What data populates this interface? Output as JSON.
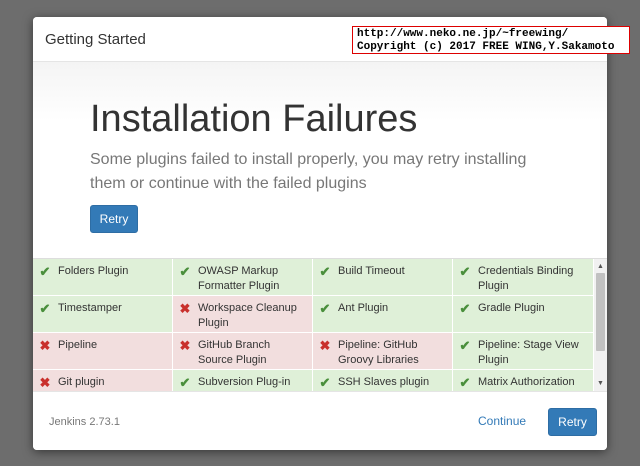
{
  "dialog": {
    "title": "Getting Started"
  },
  "watermark": {
    "line1": "http://www.neko.ne.jp/~freewing/",
    "line2": "Copyright (c) 2017 FREE WING,Y.Sakamoto"
  },
  "hero": {
    "title": "Installation Failures",
    "text": "Some plugins failed to install properly, you may retry installing them or continue with the failed plugins",
    "retry_label": "Retry"
  },
  "plugins": [
    {
      "name": "Folders Plugin",
      "status": "success"
    },
    {
      "name": "OWASP Markup Formatter Plugin",
      "status": "success"
    },
    {
      "name": "Build Timeout",
      "status": "success"
    },
    {
      "name": "Credentials Binding Plugin",
      "status": "success"
    },
    {
      "name": "Timestamper",
      "status": "success"
    },
    {
      "name": "Workspace Cleanup Plugin",
      "status": "failed"
    },
    {
      "name": "Ant Plugin",
      "status": "success"
    },
    {
      "name": "Gradle Plugin",
      "status": "success"
    },
    {
      "name": "Pipeline",
      "status": "failed"
    },
    {
      "name": "GitHub Branch Source Plugin",
      "status": "failed"
    },
    {
      "name": "Pipeline: GitHub Groovy Libraries",
      "status": "failed"
    },
    {
      "name": "Pipeline: Stage View Plugin",
      "status": "success"
    },
    {
      "name": "Git plugin",
      "status": "failed"
    },
    {
      "name": "Subversion Plug-in",
      "status": "success"
    },
    {
      "name": "SSH Slaves plugin",
      "status": "success"
    },
    {
      "name": "Matrix Authorization",
      "status": "success"
    }
  ],
  "icons": {
    "success": "check-icon",
    "failed": "x-icon",
    "success_glyph": "✔",
    "failed_glyph": "✖",
    "scroll_up_glyph": "▲",
    "scroll_down_glyph": "▼"
  },
  "footer": {
    "version": "Jenkins 2.73.1",
    "continue_label": "Continue",
    "retry_label": "Retry"
  },
  "colors": {
    "accent": "#337ab7",
    "success_bg": "#dff0d8",
    "failed_bg": "#f2dede",
    "success_icon": "#4a8f3c",
    "failed_icon": "#c9302c"
  }
}
